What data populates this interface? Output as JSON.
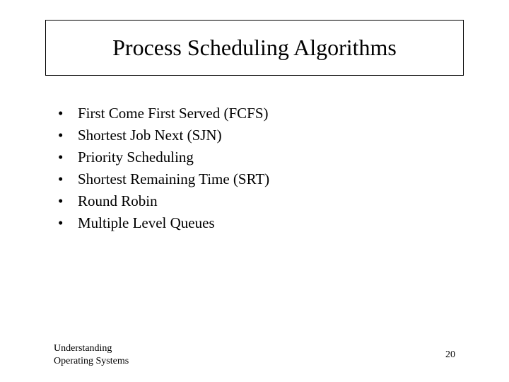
{
  "title": "Process Scheduling Algorithms",
  "bullets": [
    "First Come First Served (FCFS)",
    "Shortest Job Next (SJN)",
    "Priority Scheduling",
    "Shortest Remaining Time (SRT)",
    "Round Robin",
    "Multiple Level Queues"
  ],
  "footer": {
    "line1": "Understanding",
    "line2": "Operating Systems",
    "page": "20"
  }
}
